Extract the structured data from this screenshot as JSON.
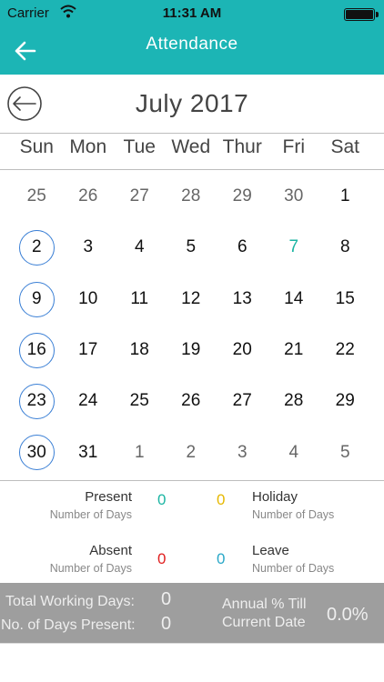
{
  "status_bar": {
    "carrier": "Carrier",
    "time": "11:31 AM"
  },
  "nav": {
    "title": "Attendance"
  },
  "calendar": {
    "month_title": "July 2017",
    "weekdays": [
      "Sun",
      "Mon",
      "Tue",
      "Wed",
      "Thur",
      "Fri",
      "Sat"
    ],
    "weeks": [
      [
        "25",
        "26",
        "27",
        "28",
        "29",
        "30",
        "1"
      ],
      [
        "2",
        "3",
        "4",
        "5",
        "6",
        "7",
        "8"
      ],
      [
        "9",
        "10",
        "11",
        "12",
        "13",
        "14",
        "15"
      ],
      [
        "16",
        "17",
        "18",
        "19",
        "20",
        "21",
        "22"
      ],
      [
        "23",
        "24",
        "25",
        "26",
        "27",
        "28",
        "29"
      ],
      [
        "30",
        "31",
        "1",
        "2",
        "3",
        "4",
        "5"
      ]
    ]
  },
  "summary": {
    "present": {
      "label": "Present",
      "sub": "Number of Days",
      "value": "0",
      "color": "#1cb5a3"
    },
    "holiday": {
      "label": "Holiday",
      "sub": "Number of Days",
      "value": "0",
      "color": "#e6b800"
    },
    "absent": {
      "label": "Absent",
      "sub": "Number of Days",
      "value": "0",
      "color": "#e02020"
    },
    "leave": {
      "label": "Leave",
      "sub": "Number of Days",
      "value": "0",
      "color": "#2aa8c8"
    }
  },
  "footer": {
    "total_working_label": "Total Working Days:",
    "total_working_value": "0",
    "present_days_label": "No. of Days Present:",
    "present_days_value": "0",
    "annual_label_1": "Annual % Till",
    "annual_label_2": "Current Date",
    "annual_value": "0.0%"
  },
  "colors": {
    "accent": "#1cb5b5",
    "circle": "#3a7fd5",
    "footer_bg": "#9e9e9e"
  }
}
